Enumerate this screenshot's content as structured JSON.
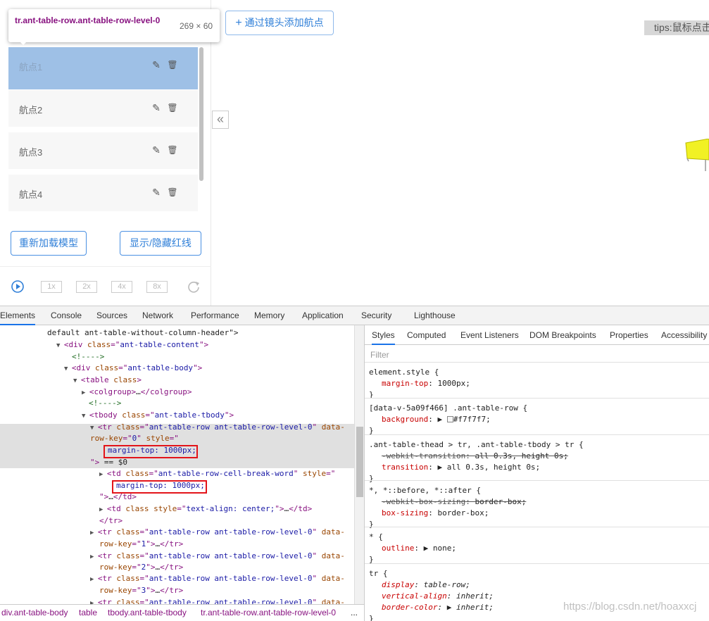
{
  "tooltip": {
    "selector": "tr.ant-table-row.ant-table-row-level-0",
    "size": "269 × 60"
  },
  "add_waypoint_button": "通过镜头添加航点",
  "tips": "tips:鼠标点击",
  "waypoints": [
    {
      "label": "航点1",
      "selected": true
    },
    {
      "label": "航点2",
      "selected": false
    },
    {
      "label": "航点3",
      "selected": false
    },
    {
      "label": "航点4",
      "selected": false
    }
  ],
  "reload_model_button": "重新加载模型",
  "toggle_redline_button": "显示/隐藏红线",
  "speeds": [
    "1x",
    "2x",
    "4x",
    "8x"
  ],
  "collapse_glyph": "«",
  "devtools": {
    "tabs": [
      "Elements",
      "Console",
      "Sources",
      "Network",
      "Performance",
      "Memory",
      "Application",
      "Security",
      "Lighthouse"
    ],
    "active_tab": "Elements",
    "dom_lines": [
      {
        "parts": [
          [
            "tx",
            "default ant-table-without-column-header\">"
          ]
        ]
      },
      {
        "parts": [
          [
            "tri",
            "▼"
          ],
          [
            "tg",
            "<div "
          ],
          [
            "at",
            "class"
          ],
          [
            "tg",
            "=\""
          ],
          [
            "av",
            "ant-table-content"
          ],
          [
            "tg",
            "\">"
          ]
        ]
      },
      {
        "parts": [
          [
            "cm",
            "<!---->"
          ]
        ]
      },
      {
        "parts": [
          [
            "tri",
            "▼"
          ],
          [
            "tg",
            "<div "
          ],
          [
            "at",
            "class"
          ],
          [
            "tg",
            "=\""
          ],
          [
            "av",
            "ant-table-body"
          ],
          [
            "tg",
            "\">"
          ]
        ]
      },
      {
        "parts": [
          [
            "tri",
            "▼"
          ],
          [
            "tg",
            "<table "
          ],
          [
            "at",
            "class"
          ],
          [
            "tg",
            ">"
          ]
        ]
      },
      {
        "parts": [
          [
            "tri",
            "▶"
          ],
          [
            "tg",
            "<colgroup>"
          ],
          [
            "tx",
            "…"
          ],
          [
            "tg",
            "</colgroup>"
          ]
        ]
      },
      {
        "parts": [
          [
            "cm",
            "<!---->"
          ]
        ]
      },
      {
        "parts": [
          [
            "tri",
            "▼"
          ],
          [
            "tg",
            "<tbody "
          ],
          [
            "at",
            "class"
          ],
          [
            "tg",
            "=\""
          ],
          [
            "av",
            "ant-table-tbody"
          ],
          [
            "tg",
            "\">"
          ]
        ]
      },
      {
        "parts": [
          [
            "tri",
            "▼"
          ],
          [
            "tg",
            "<tr "
          ],
          [
            "at",
            "class"
          ],
          [
            "tg",
            "=\""
          ],
          [
            "av",
            "ant-table-row ant-table-row-level-0"
          ],
          [
            "tg",
            "\" "
          ],
          [
            "at",
            "data-"
          ]
        ]
      },
      {
        "parts": [
          [
            "at",
            "row-key"
          ],
          [
            "tg",
            "=\""
          ],
          [
            "av",
            "0"
          ],
          [
            "tg",
            "\" "
          ],
          [
            "at",
            "style"
          ],
          [
            "tg",
            "=\""
          ]
        ]
      },
      {
        "parts": [
          [
            "av",
            "margin-top: 1000px;"
          ]
        ]
      },
      {
        "parts": [
          [
            "tg",
            "\">"
          ],
          [
            "tx",
            " == $0"
          ]
        ]
      },
      {
        "parts": [
          [
            "tri",
            "▶"
          ],
          [
            "tg",
            "<td "
          ],
          [
            "at",
            "class"
          ],
          [
            "tg",
            "=\""
          ],
          [
            "av",
            "ant-table-row-cell-break-word"
          ],
          [
            "tg",
            "\" "
          ],
          [
            "at",
            "style"
          ],
          [
            "tg",
            "=\""
          ]
        ]
      },
      {
        "parts": [
          [
            "av",
            "margin-top: 1000px;"
          ]
        ]
      },
      {
        "parts": [
          [
            "tg",
            "\">"
          ],
          [
            "tx",
            "…"
          ],
          [
            "tg",
            "</td>"
          ]
        ]
      },
      {
        "parts": [
          [
            "tri",
            "▶"
          ],
          [
            "tg",
            "<td "
          ],
          [
            "at",
            "class"
          ],
          [
            "tg",
            " "
          ],
          [
            "at",
            "style"
          ],
          [
            "tg",
            "=\""
          ],
          [
            "av",
            "text-align: center;"
          ],
          [
            "tg",
            "\">"
          ],
          [
            "tx",
            "…"
          ],
          [
            "tg",
            "</td>"
          ]
        ]
      },
      {
        "parts": [
          [
            "tg",
            "</tr>"
          ]
        ]
      },
      {
        "parts": [
          [
            "tri",
            "▶"
          ],
          [
            "tg",
            "<tr "
          ],
          [
            "at",
            "class"
          ],
          [
            "tg",
            "=\""
          ],
          [
            "av",
            "ant-table-row ant-table-row-level-0"
          ],
          [
            "tg",
            "\" "
          ],
          [
            "at",
            "data-"
          ]
        ]
      },
      {
        "parts": [
          [
            "at",
            "row-key"
          ],
          [
            "tg",
            "=\""
          ],
          [
            "av",
            "1"
          ],
          [
            "tg",
            "\">"
          ],
          [
            "tx",
            "…"
          ],
          [
            "tg",
            "</tr>"
          ]
        ]
      },
      {
        "parts": [
          [
            "tri",
            "▶"
          ],
          [
            "tg",
            "<tr "
          ],
          [
            "at",
            "class"
          ],
          [
            "tg",
            "=\""
          ],
          [
            "av",
            "ant-table-row ant-table-row-level-0"
          ],
          [
            "tg",
            "\" "
          ],
          [
            "at",
            "data-"
          ]
        ]
      },
      {
        "parts": [
          [
            "at",
            "row-key"
          ],
          [
            "tg",
            "=\""
          ],
          [
            "av",
            "2"
          ],
          [
            "tg",
            "\">"
          ],
          [
            "tx",
            "…"
          ],
          [
            "tg",
            "</tr>"
          ]
        ]
      },
      {
        "parts": [
          [
            "tri",
            "▶"
          ],
          [
            "tg",
            "<tr "
          ],
          [
            "at",
            "class"
          ],
          [
            "tg",
            "=\""
          ],
          [
            "av",
            "ant-table-row ant-table-row-level-0"
          ],
          [
            "tg",
            "\" "
          ],
          [
            "at",
            "data-"
          ]
        ]
      },
      {
        "parts": [
          [
            "at",
            "row-key"
          ],
          [
            "tg",
            "=\""
          ],
          [
            "av",
            "3"
          ],
          [
            "tg",
            "\">"
          ],
          [
            "tx",
            "…"
          ],
          [
            "tg",
            "</tr>"
          ]
        ]
      },
      {
        "parts": [
          [
            "tri",
            "▶"
          ],
          [
            "tg",
            "<tr "
          ],
          [
            "at",
            "class"
          ],
          [
            "tg",
            "=\""
          ],
          [
            "av",
            "ant-table-row ant-table-row-level-0"
          ],
          [
            "tg",
            "\" "
          ],
          [
            "at",
            "data-"
          ]
        ]
      }
    ],
    "breadcrumb": [
      "div.ant-table-body",
      "table",
      "tbody.ant-table-tbody",
      "tr.ant-table-row.ant-table-row-level-0",
      "..."
    ],
    "styles_tabs": [
      "Styles",
      "Computed",
      "Event Listeners",
      "DOM Breakpoints",
      "Properties",
      "Accessibility"
    ],
    "filter_placeholder": "Filter",
    "rules": [
      {
        "selector": "element.style {",
        "props": [
          {
            "name": "margin-top",
            "value": "1000px;"
          }
        ]
      },
      {
        "selector": "[data-v-5a09f466] .ant-table-row {",
        "props": [
          {
            "name": "background",
            "value": "#f7f7f7;",
            "swatch": true
          }
        ]
      },
      {
        "selector": ".ant-table-thead > tr, .ant-table-tbody > tr {",
        "props": [
          {
            "name": "-webkit-transition",
            "value": "all 0.3s, height 0s;",
            "struck": true
          },
          {
            "name": "transition",
            "value": "▶ all 0.3s, height 0s;"
          }
        ]
      },
      {
        "selector": "*, *::before, *::after {",
        "props": [
          {
            "name": "-webkit-box-sizing",
            "value": "border-box;",
            "struck": true
          },
          {
            "name": "box-sizing",
            "value": "border-box;"
          }
        ]
      },
      {
        "selector": "* {",
        "props": [
          {
            "name": "outline",
            "value": "▶ none;"
          }
        ]
      },
      {
        "selector": "tr {",
        "props": [
          {
            "name": "display",
            "value": "table-row;",
            "italic": true
          },
          {
            "name": "vertical-align",
            "value": "inherit;",
            "italic": true
          },
          {
            "name": "border-color",
            "value": "▶ inherit;",
            "italic": true
          }
        ]
      }
    ],
    "rule_close": "}"
  },
  "watermark": "https://blog.csdn.net/hoaxxcj"
}
